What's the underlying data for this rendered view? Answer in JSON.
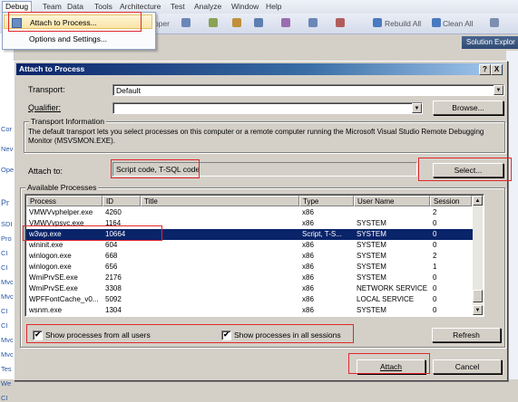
{
  "ide": {
    "menus": [
      "Debug",
      "Team",
      "Data",
      "Tools",
      "Architecture",
      "Test",
      "Analyze",
      "Window",
      "Help"
    ],
    "toolbar": {
      "snippet": "ipper",
      "rebuild": "Rebuild All",
      "clean": "Clean All",
      "tab": "Solution Explor"
    },
    "side_labels": [
      "Cor",
      "Nev",
      "Ope",
      "Pr",
      "SDI",
      "Pro",
      "CI",
      "CI",
      "Mvc",
      "Mvc",
      "CI",
      "CI",
      "Mvc",
      "Mvc",
      "Tes",
      "We",
      "CI"
    ]
  },
  "debug_menu": {
    "title": "Debug",
    "items": [
      "Attach to Process...",
      "Options and Settings..."
    ]
  },
  "dialog": {
    "title": "Attach to Process",
    "help_btn": "?",
    "close_btn": "X",
    "transport_label": "Transport:",
    "transport_value": "Default",
    "qualifier_label": "Qualifier:",
    "qualifier_value": "",
    "browse_btn": "Browse...",
    "transport_info": {
      "legend": "Transport Information",
      "text": "The default transport lets you select processes on this computer or a remote computer running the Microsoft Visual Studio Remote Debugging Monitor (MSVSMON.EXE)."
    },
    "attach_to_label": "Attach to:",
    "attach_to_value": "Script code, T-SQL code",
    "select_btn": "Select...",
    "available": {
      "legend": "Available Processes",
      "columns": [
        "Process",
        "ID",
        "Title",
        "Type",
        "User Name",
        "Session"
      ],
      "rows": [
        {
          "process": "VMWVvphelper.exe",
          "id": "4260",
          "title": "",
          "type": "x86",
          "user": "",
          "session": "2"
        },
        {
          "process": "VMWVvpsvc.exe",
          "id": "1164",
          "title": "",
          "type": "x86",
          "user": "SYSTEM",
          "session": "0"
        },
        {
          "process": "w3wp.exe",
          "id": "10664",
          "title": "",
          "type": "Script, T-S...",
          "user": "SYSTEM",
          "session": "0"
        },
        {
          "process": "wininit.exe",
          "id": "604",
          "title": "",
          "type": "x86",
          "user": "SYSTEM",
          "session": "0"
        },
        {
          "process": "winlogon.exe",
          "id": "668",
          "title": "",
          "type": "x86",
          "user": "SYSTEM",
          "session": "2"
        },
        {
          "process": "winlogon.exe",
          "id": "656",
          "title": "",
          "type": "x86",
          "user": "SYSTEM",
          "session": "1"
        },
        {
          "process": "WmiPrvSE.exe",
          "id": "2176",
          "title": "",
          "type": "x86",
          "user": "SYSTEM",
          "session": "0"
        },
        {
          "process": "WmiPrvSE.exe",
          "id": "3308",
          "title": "",
          "type": "x86",
          "user": "NETWORK SERVICE",
          "session": "0"
        },
        {
          "process": "WPFFontCache_v0...",
          "id": "5092",
          "title": "",
          "type": "x86",
          "user": "LOCAL SERVICE",
          "session": "0"
        },
        {
          "process": "wsnm.exe",
          "id": "1304",
          "title": "",
          "type": "x86",
          "user": "SYSTEM",
          "session": "0"
        }
      ],
      "selected_index": 2
    },
    "show_all_users": {
      "label": "Show processes from all users",
      "checked": true
    },
    "show_all_sessions": {
      "label": "Show processes in all sessions",
      "checked": true
    },
    "refresh_btn": "Refresh",
    "attach_btn": "Attach",
    "cancel_btn": "Cancel",
    "check_mark": "✔"
  }
}
